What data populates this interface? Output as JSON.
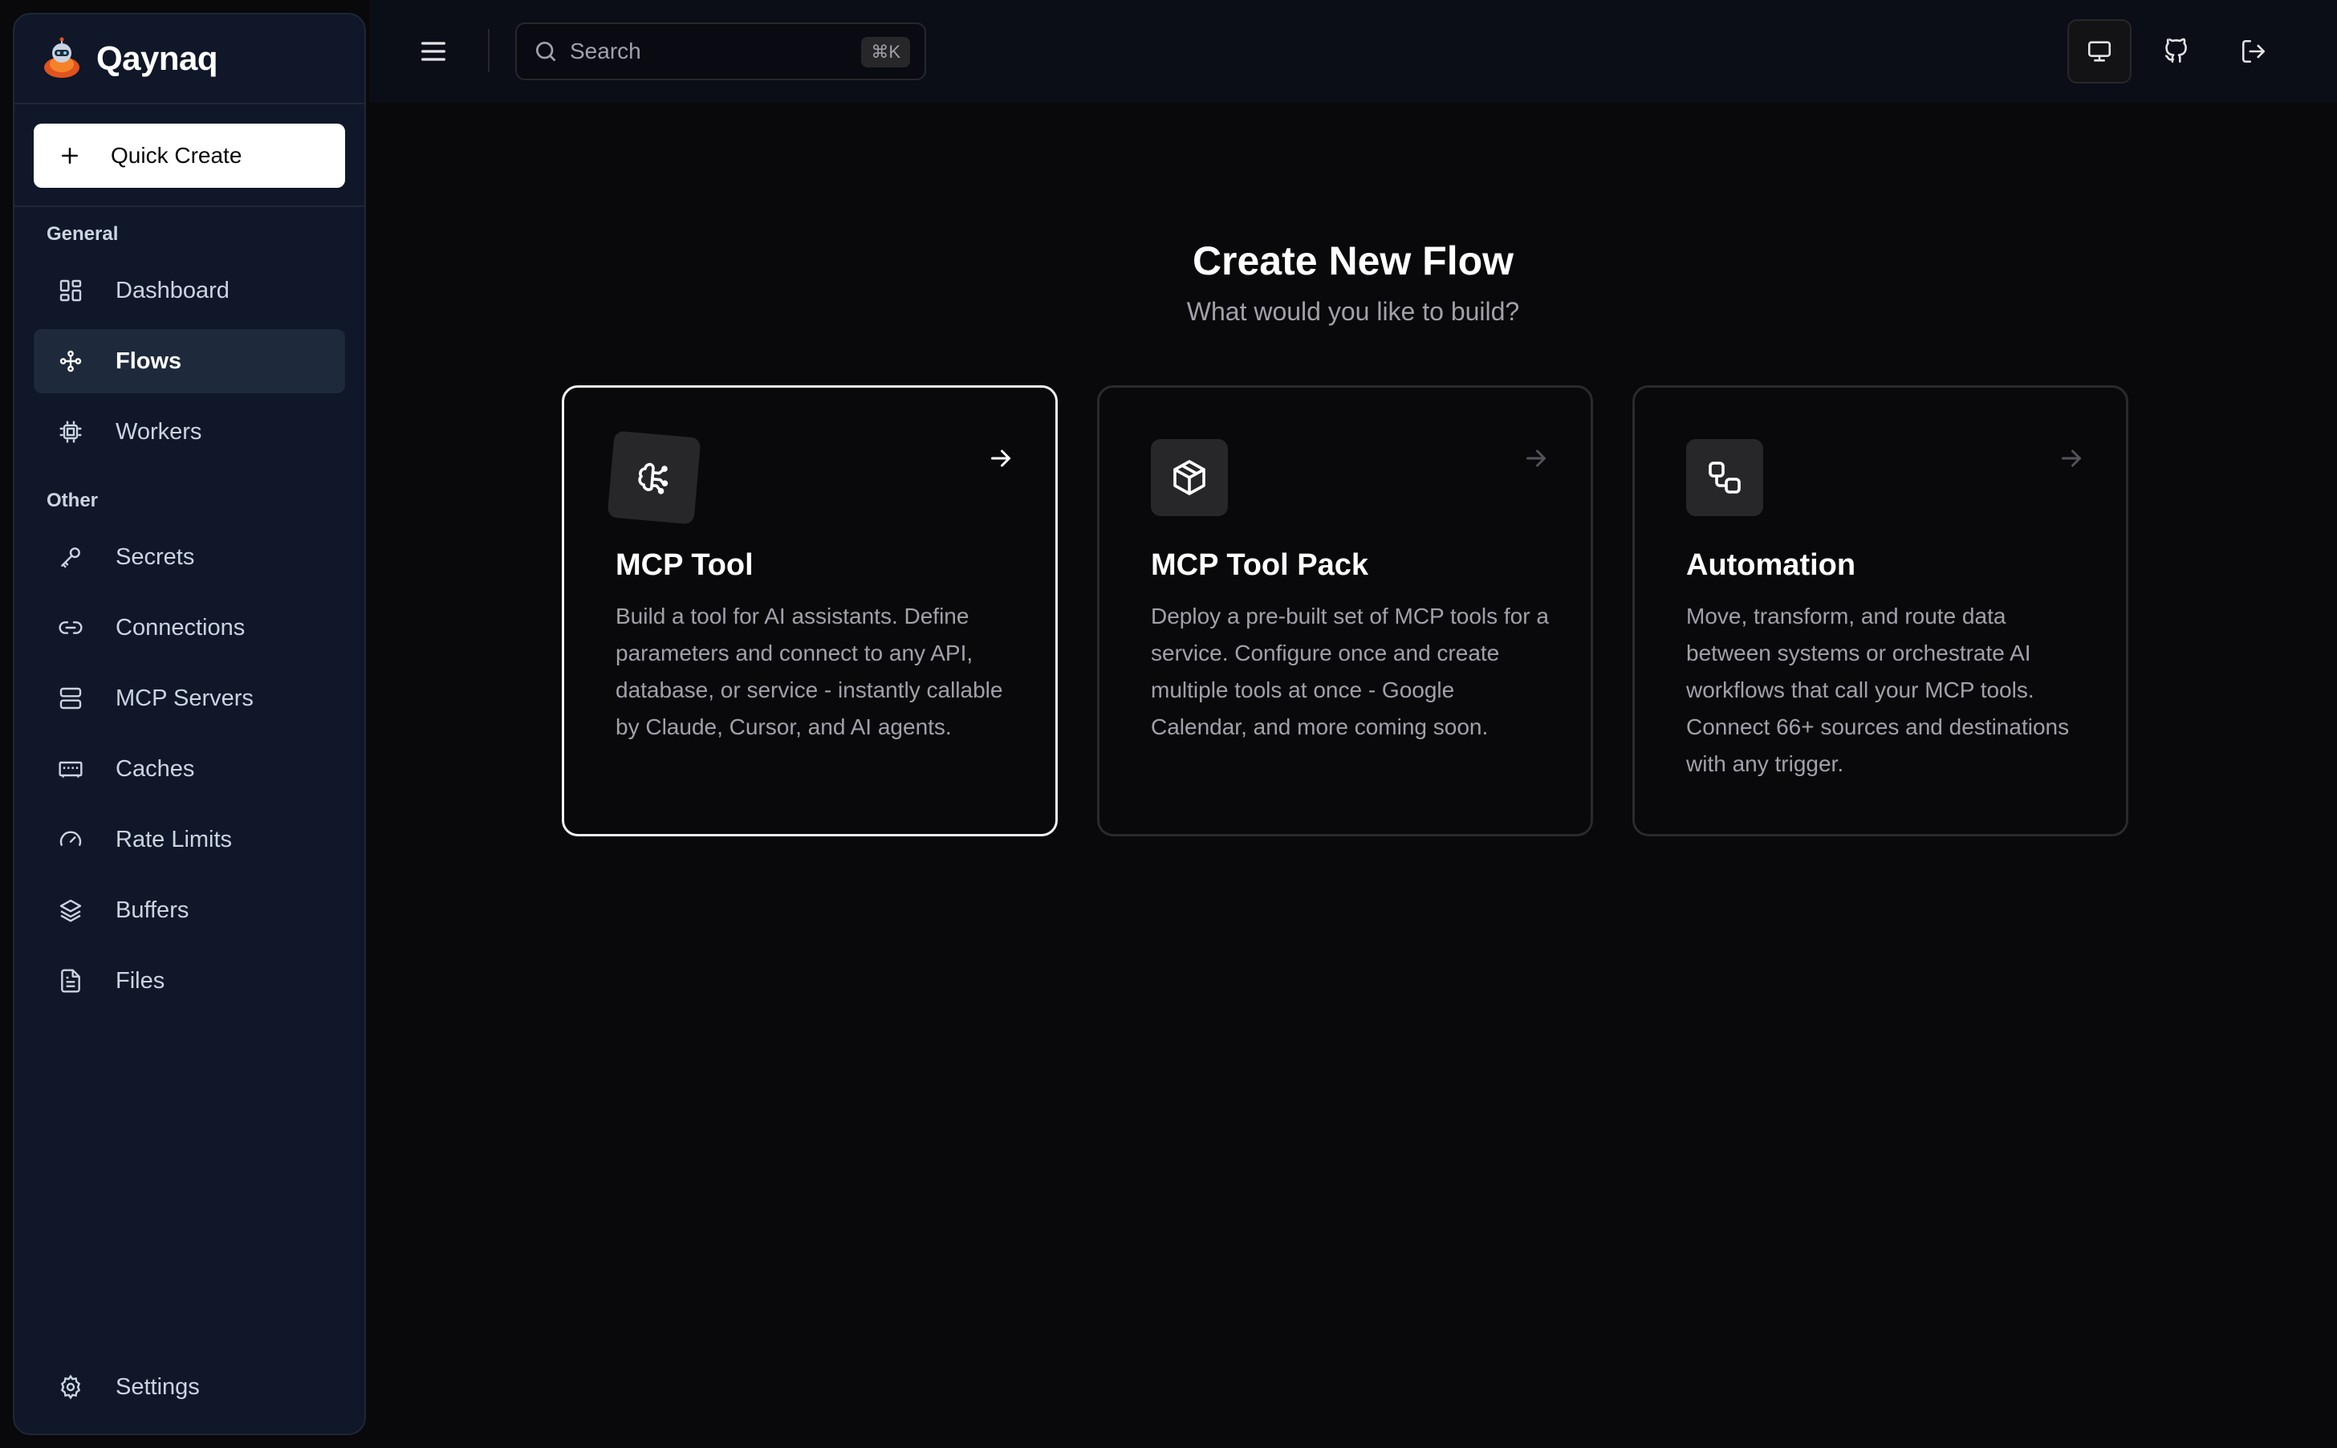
{
  "brand": {
    "name": "Qaynaq"
  },
  "sidebar": {
    "quick_create": "Quick Create",
    "groups": [
      {
        "label": "General"
      },
      {
        "label": "Other"
      }
    ],
    "general_items": [
      {
        "label": "Dashboard",
        "icon": "dashboard-icon"
      },
      {
        "label": "Flows",
        "icon": "flows-icon",
        "active": true
      },
      {
        "label": "Workers",
        "icon": "cpu-icon"
      }
    ],
    "other_items": [
      {
        "label": "Secrets",
        "icon": "key-icon"
      },
      {
        "label": "Connections",
        "icon": "link-icon"
      },
      {
        "label": "MCP Servers",
        "icon": "server-icon"
      },
      {
        "label": "Caches",
        "icon": "memory-icon"
      },
      {
        "label": "Rate Limits",
        "icon": "gauge-icon"
      },
      {
        "label": "Buffers",
        "icon": "layers-icon"
      },
      {
        "label": "Files",
        "icon": "file-icon"
      }
    ],
    "settings": {
      "label": "Settings",
      "icon": "gear-icon"
    }
  },
  "topbar": {
    "search_placeholder": "Search",
    "search_shortcut": "⌘K",
    "icons": [
      "monitor-icon",
      "github-icon",
      "logout-icon"
    ]
  },
  "main": {
    "title": "Create New Flow",
    "subtitle": "What would you like to build?",
    "cards": [
      {
        "title": "MCP Tool",
        "icon": "brain-icon",
        "selected": true,
        "description": "Build a tool for AI assistants. Define parameters and connect to any API, database, or service - instantly callable by Claude, Cursor, and AI agents."
      },
      {
        "title": "MCP Tool Pack",
        "icon": "package-icon",
        "description": "Deploy a pre-built set of MCP tools for a service. Configure once and create multiple tools at once - Google Calendar, and more coming soon."
      },
      {
        "title": "Automation",
        "icon": "workflow-icon",
        "description": "Move, transform, and route data between systems or orchestrate AI workflows that call your MCP tools. Connect 66+ sources and destinations with any trigger."
      }
    ]
  },
  "colors": {
    "background": "#09090b",
    "sidebar": "#0f1729",
    "active_nav": "#1e293b",
    "muted_text": "#a1a1aa"
  }
}
